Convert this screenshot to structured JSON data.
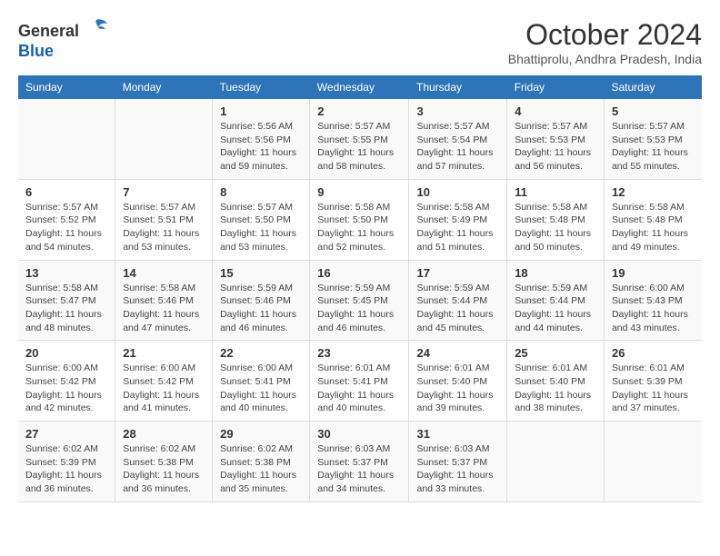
{
  "header": {
    "logo_line1": "General",
    "logo_line2": "Blue",
    "month_title": "October 2024",
    "location": "Bhattiprolu, Andhra Pradesh, India"
  },
  "weekdays": [
    "Sunday",
    "Monday",
    "Tuesday",
    "Wednesday",
    "Thursday",
    "Friday",
    "Saturday"
  ],
  "weeks": [
    [
      {
        "day": "",
        "info": ""
      },
      {
        "day": "",
        "info": ""
      },
      {
        "day": "1",
        "info": "Sunrise: 5:56 AM\nSunset: 5:56 PM\nDaylight: 11 hours and 59 minutes."
      },
      {
        "day": "2",
        "info": "Sunrise: 5:57 AM\nSunset: 5:55 PM\nDaylight: 11 hours and 58 minutes."
      },
      {
        "day": "3",
        "info": "Sunrise: 5:57 AM\nSunset: 5:54 PM\nDaylight: 11 hours and 57 minutes."
      },
      {
        "day": "4",
        "info": "Sunrise: 5:57 AM\nSunset: 5:53 PM\nDaylight: 11 hours and 56 minutes."
      },
      {
        "day": "5",
        "info": "Sunrise: 5:57 AM\nSunset: 5:53 PM\nDaylight: 11 hours and 55 minutes."
      }
    ],
    [
      {
        "day": "6",
        "info": "Sunrise: 5:57 AM\nSunset: 5:52 PM\nDaylight: 11 hours and 54 minutes."
      },
      {
        "day": "7",
        "info": "Sunrise: 5:57 AM\nSunset: 5:51 PM\nDaylight: 11 hours and 53 minutes."
      },
      {
        "day": "8",
        "info": "Sunrise: 5:57 AM\nSunset: 5:50 PM\nDaylight: 11 hours and 53 minutes."
      },
      {
        "day": "9",
        "info": "Sunrise: 5:58 AM\nSunset: 5:50 PM\nDaylight: 11 hours and 52 minutes."
      },
      {
        "day": "10",
        "info": "Sunrise: 5:58 AM\nSunset: 5:49 PM\nDaylight: 11 hours and 51 minutes."
      },
      {
        "day": "11",
        "info": "Sunrise: 5:58 AM\nSunset: 5:48 PM\nDaylight: 11 hours and 50 minutes."
      },
      {
        "day": "12",
        "info": "Sunrise: 5:58 AM\nSunset: 5:48 PM\nDaylight: 11 hours and 49 minutes."
      }
    ],
    [
      {
        "day": "13",
        "info": "Sunrise: 5:58 AM\nSunset: 5:47 PM\nDaylight: 11 hours and 48 minutes."
      },
      {
        "day": "14",
        "info": "Sunrise: 5:58 AM\nSunset: 5:46 PM\nDaylight: 11 hours and 47 minutes."
      },
      {
        "day": "15",
        "info": "Sunrise: 5:59 AM\nSunset: 5:46 PM\nDaylight: 11 hours and 46 minutes."
      },
      {
        "day": "16",
        "info": "Sunrise: 5:59 AM\nSunset: 5:45 PM\nDaylight: 11 hours and 46 minutes."
      },
      {
        "day": "17",
        "info": "Sunrise: 5:59 AM\nSunset: 5:44 PM\nDaylight: 11 hours and 45 minutes."
      },
      {
        "day": "18",
        "info": "Sunrise: 5:59 AM\nSunset: 5:44 PM\nDaylight: 11 hours and 44 minutes."
      },
      {
        "day": "19",
        "info": "Sunrise: 6:00 AM\nSunset: 5:43 PM\nDaylight: 11 hours and 43 minutes."
      }
    ],
    [
      {
        "day": "20",
        "info": "Sunrise: 6:00 AM\nSunset: 5:42 PM\nDaylight: 11 hours and 42 minutes."
      },
      {
        "day": "21",
        "info": "Sunrise: 6:00 AM\nSunset: 5:42 PM\nDaylight: 11 hours and 41 minutes."
      },
      {
        "day": "22",
        "info": "Sunrise: 6:00 AM\nSunset: 5:41 PM\nDaylight: 11 hours and 40 minutes."
      },
      {
        "day": "23",
        "info": "Sunrise: 6:01 AM\nSunset: 5:41 PM\nDaylight: 11 hours and 40 minutes."
      },
      {
        "day": "24",
        "info": "Sunrise: 6:01 AM\nSunset: 5:40 PM\nDaylight: 11 hours and 39 minutes."
      },
      {
        "day": "25",
        "info": "Sunrise: 6:01 AM\nSunset: 5:40 PM\nDaylight: 11 hours and 38 minutes."
      },
      {
        "day": "26",
        "info": "Sunrise: 6:01 AM\nSunset: 5:39 PM\nDaylight: 11 hours and 37 minutes."
      }
    ],
    [
      {
        "day": "27",
        "info": "Sunrise: 6:02 AM\nSunset: 5:39 PM\nDaylight: 11 hours and 36 minutes."
      },
      {
        "day": "28",
        "info": "Sunrise: 6:02 AM\nSunset: 5:38 PM\nDaylight: 11 hours and 36 minutes."
      },
      {
        "day": "29",
        "info": "Sunrise: 6:02 AM\nSunset: 5:38 PM\nDaylight: 11 hours and 35 minutes."
      },
      {
        "day": "30",
        "info": "Sunrise: 6:03 AM\nSunset: 5:37 PM\nDaylight: 11 hours and 34 minutes."
      },
      {
        "day": "31",
        "info": "Sunrise: 6:03 AM\nSunset: 5:37 PM\nDaylight: 11 hours and 33 minutes."
      },
      {
        "day": "",
        "info": ""
      },
      {
        "day": "",
        "info": ""
      }
    ]
  ]
}
